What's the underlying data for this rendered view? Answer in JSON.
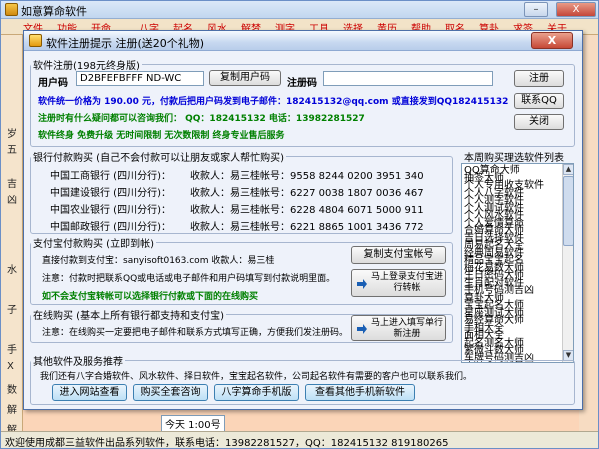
{
  "main": {
    "title": "如意算命软件",
    "menu": [
      "文件",
      "功能",
      "开命",
      "八字",
      "起名",
      "风水",
      "解梦",
      "测字",
      "工具",
      "选择",
      "黄历",
      "帮助",
      "取名",
      "算卦",
      "求签",
      "关于"
    ],
    "left_strip": [
      "岁",
      "五",
      "吉",
      "凶",
      "水",
      "子",
      "手",
      "X",
      "数",
      "解",
      "解"
    ],
    "status": "欢迎使用成都三益软件出品系列软件，联系电话：13982281527，QQ：182415132  819180265",
    "bottom_hint": "今天 1:00号"
  },
  "dialog": {
    "title": "软件注册提示 注册(送20个礼物)",
    "close": "X",
    "register_group": {
      "legend": "软件注册(198元终身版)",
      "user_code_label": "用户码",
      "user_code_value": "D2BFEFBFFF       ND-WC",
      "copy_button": "复制用户码",
      "reg_code_label": "注册码",
      "reg_code_value": "",
      "register_button": "注册",
      "contact_qq_button": "联系QQ",
      "close_button": "关闭",
      "line1": "软件统一价格为 190.00 元，付款后把用户码发到电子邮件：182415132@qq.com 或直接发到QQ182415132",
      "line2": "注册时有什么疑问都可以咨询我们：    QQ：182415132      电话：13982281527",
      "line3": "软件终身  免费升级  无时间限制  无次数限制  终身专业售后服务"
    },
    "bank_group": {
      "legend": "银行付款购买 (自己不会付款可以让朋友或家人帮忙购买)",
      "rows": [
        {
          "bank": "中国工商银行 (四川分行)：",
          "payee": "收款人：易三桂",
          "acct": "帐号：9558 8244 0200 3951 340"
        },
        {
          "bank": "中国建设银行 (四川分行)：",
          "payee": "收款人：易三桂",
          "acct": "帐号：6227 0038 1807 0036 467"
        },
        {
          "bank": "中国农业银行 (四川分行)：",
          "payee": "收款人：易三桂",
          "acct": "帐号：6228 4804 6071 5000 911"
        },
        {
          "bank": "中国邮政银行 (四川分行)：",
          "payee": "收款人：易三桂",
          "acct": "帐号：6221 8865 1001 3436 772"
        }
      ]
    },
    "alipay_group": {
      "legend": "支付宝付款购买 (立即到帐)",
      "line1": "直接付款到支付宝：sanyisoft0163.com 收款人：易三桂",
      "line2": "注意：付款时把联系QQ或电话或电子邮件和用户码填写到付款说明里面。",
      "line3": "如不会支付宝转帐可以选择银行付款或下面的在线购买",
      "copy_button": "复制支付宝帐号",
      "login_button": "马上登录支付宝进行转帐"
    },
    "online_group": {
      "legend": "在线购买 (基本上所有银行都支持和支付宝)",
      "line1": "注意：在线购买一定要把电子邮件和联系方式填写正确，方便我们发注册码。",
      "buy_button": "马上进入填写单行新注册"
    },
    "other_group": {
      "legend": "其他软件及服务推荐",
      "line1": "我们还有八字合婚软件、风水软件、择日软件，宝宝起名软件，公司起名软件有需要的客户也可以联系我们。",
      "buttons": [
        "进入网站查看",
        "购买全套咨询",
        "八字算命手机版",
        "查看其他手机新软件"
      ]
    },
    "bank_list": {
      "title": "本周购买理选软件列表",
      "items": [
        "QQ算命大师",
        "抽签大师",
        "个人专用收支软件",
        "个人八字软件",
        "个人测字软件",
        "个人测试软件",
        "个人风水软件",
        "个人爱情算命",
        "合婚算命大师",
        "吉日选择软件",
        "周易起名大全",
        "经典周易软件",
        "精品宝宝起名",
        "梅花易数大师",
        "生日密码大师",
        "生肖配对软件",
        "手机号码测吉凶",
        "算卦大师",
        "宝宝起名大师",
        "星座测试大师",
        "易经算命大师",
        "手相大全",
        "面相大全",
        "起名测名大师",
        "紫微斗数大师",
        "车牌号码测吉凶"
      ]
    }
  }
}
